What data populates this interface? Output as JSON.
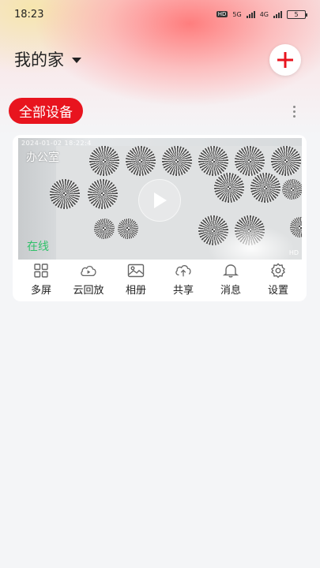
{
  "status_bar": {
    "time": "18:23",
    "hd_badge": "HD",
    "net1": "5G",
    "net2": "4G",
    "battery": "5"
  },
  "header": {
    "home_name": "我的家"
  },
  "filter": {
    "all_devices_label": "全部设备"
  },
  "device": {
    "name": "办公室",
    "timestamp": "2024-01-02 18:22:4",
    "status": "在线",
    "quality": "HD"
  },
  "actions": [
    {
      "label": "多屏",
      "icon": "grid-icon"
    },
    {
      "label": "云回放",
      "icon": "cloud-play-icon"
    },
    {
      "label": "相册",
      "icon": "album-icon"
    },
    {
      "label": "共享",
      "icon": "cloud-upload-icon"
    },
    {
      "label": "消息",
      "icon": "bell-icon"
    },
    {
      "label": "设置",
      "icon": "gear-icon"
    }
  ],
  "colors": {
    "accent": "#e8141e",
    "online": "#31c16a"
  }
}
